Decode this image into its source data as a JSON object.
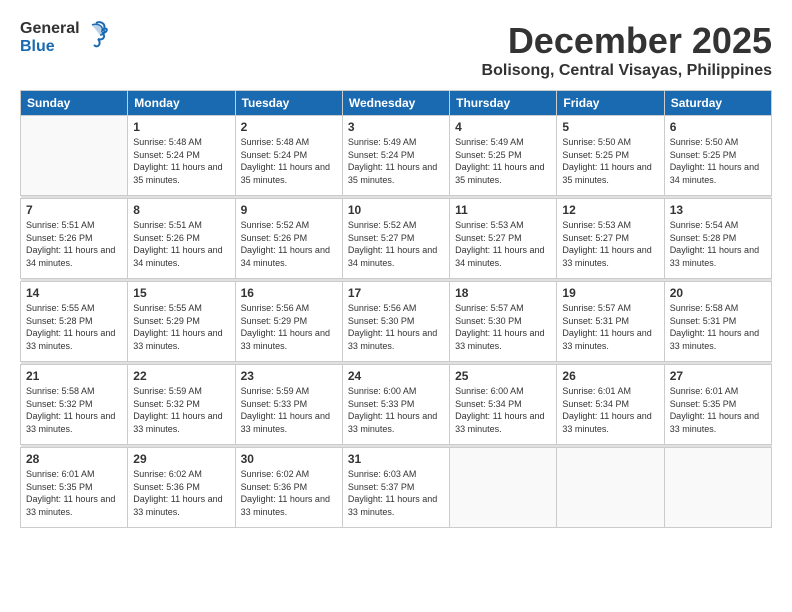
{
  "logo": {
    "text_general": "General",
    "text_blue": "Blue"
  },
  "title": {
    "month_year": "December 2025",
    "location": "Bolisong, Central Visayas, Philippines"
  },
  "header_days": [
    "Sunday",
    "Monday",
    "Tuesday",
    "Wednesday",
    "Thursday",
    "Friday",
    "Saturday"
  ],
  "weeks": [
    [
      {
        "day": "",
        "sunrise": "",
        "sunset": "",
        "daylight": ""
      },
      {
        "day": "1",
        "sunrise": "Sunrise: 5:48 AM",
        "sunset": "Sunset: 5:24 PM",
        "daylight": "Daylight: 11 hours and 35 minutes."
      },
      {
        "day": "2",
        "sunrise": "Sunrise: 5:48 AM",
        "sunset": "Sunset: 5:24 PM",
        "daylight": "Daylight: 11 hours and 35 minutes."
      },
      {
        "day": "3",
        "sunrise": "Sunrise: 5:49 AM",
        "sunset": "Sunset: 5:24 PM",
        "daylight": "Daylight: 11 hours and 35 minutes."
      },
      {
        "day": "4",
        "sunrise": "Sunrise: 5:49 AM",
        "sunset": "Sunset: 5:25 PM",
        "daylight": "Daylight: 11 hours and 35 minutes."
      },
      {
        "day": "5",
        "sunrise": "Sunrise: 5:50 AM",
        "sunset": "Sunset: 5:25 PM",
        "daylight": "Daylight: 11 hours and 35 minutes."
      },
      {
        "day": "6",
        "sunrise": "Sunrise: 5:50 AM",
        "sunset": "Sunset: 5:25 PM",
        "daylight": "Daylight: 11 hours and 34 minutes."
      }
    ],
    [
      {
        "day": "7",
        "sunrise": "Sunrise: 5:51 AM",
        "sunset": "Sunset: 5:26 PM",
        "daylight": "Daylight: 11 hours and 34 minutes."
      },
      {
        "day": "8",
        "sunrise": "Sunrise: 5:51 AM",
        "sunset": "Sunset: 5:26 PM",
        "daylight": "Daylight: 11 hours and 34 minutes."
      },
      {
        "day": "9",
        "sunrise": "Sunrise: 5:52 AM",
        "sunset": "Sunset: 5:26 PM",
        "daylight": "Daylight: 11 hours and 34 minutes."
      },
      {
        "day": "10",
        "sunrise": "Sunrise: 5:52 AM",
        "sunset": "Sunset: 5:27 PM",
        "daylight": "Daylight: 11 hours and 34 minutes."
      },
      {
        "day": "11",
        "sunrise": "Sunrise: 5:53 AM",
        "sunset": "Sunset: 5:27 PM",
        "daylight": "Daylight: 11 hours and 34 minutes."
      },
      {
        "day": "12",
        "sunrise": "Sunrise: 5:53 AM",
        "sunset": "Sunset: 5:27 PM",
        "daylight": "Daylight: 11 hours and 33 minutes."
      },
      {
        "day": "13",
        "sunrise": "Sunrise: 5:54 AM",
        "sunset": "Sunset: 5:28 PM",
        "daylight": "Daylight: 11 hours and 33 minutes."
      }
    ],
    [
      {
        "day": "14",
        "sunrise": "Sunrise: 5:55 AM",
        "sunset": "Sunset: 5:28 PM",
        "daylight": "Daylight: 11 hours and 33 minutes."
      },
      {
        "day": "15",
        "sunrise": "Sunrise: 5:55 AM",
        "sunset": "Sunset: 5:29 PM",
        "daylight": "Daylight: 11 hours and 33 minutes."
      },
      {
        "day": "16",
        "sunrise": "Sunrise: 5:56 AM",
        "sunset": "Sunset: 5:29 PM",
        "daylight": "Daylight: 11 hours and 33 minutes."
      },
      {
        "day": "17",
        "sunrise": "Sunrise: 5:56 AM",
        "sunset": "Sunset: 5:30 PM",
        "daylight": "Daylight: 11 hours and 33 minutes."
      },
      {
        "day": "18",
        "sunrise": "Sunrise: 5:57 AM",
        "sunset": "Sunset: 5:30 PM",
        "daylight": "Daylight: 11 hours and 33 minutes."
      },
      {
        "day": "19",
        "sunrise": "Sunrise: 5:57 AM",
        "sunset": "Sunset: 5:31 PM",
        "daylight": "Daylight: 11 hours and 33 minutes."
      },
      {
        "day": "20",
        "sunrise": "Sunrise: 5:58 AM",
        "sunset": "Sunset: 5:31 PM",
        "daylight": "Daylight: 11 hours and 33 minutes."
      }
    ],
    [
      {
        "day": "21",
        "sunrise": "Sunrise: 5:58 AM",
        "sunset": "Sunset: 5:32 PM",
        "daylight": "Daylight: 11 hours and 33 minutes."
      },
      {
        "day": "22",
        "sunrise": "Sunrise: 5:59 AM",
        "sunset": "Sunset: 5:32 PM",
        "daylight": "Daylight: 11 hours and 33 minutes."
      },
      {
        "day": "23",
        "sunrise": "Sunrise: 5:59 AM",
        "sunset": "Sunset: 5:33 PM",
        "daylight": "Daylight: 11 hours and 33 minutes."
      },
      {
        "day": "24",
        "sunrise": "Sunrise: 6:00 AM",
        "sunset": "Sunset: 5:33 PM",
        "daylight": "Daylight: 11 hours and 33 minutes."
      },
      {
        "day": "25",
        "sunrise": "Sunrise: 6:00 AM",
        "sunset": "Sunset: 5:34 PM",
        "daylight": "Daylight: 11 hours and 33 minutes."
      },
      {
        "day": "26",
        "sunrise": "Sunrise: 6:01 AM",
        "sunset": "Sunset: 5:34 PM",
        "daylight": "Daylight: 11 hours and 33 minutes."
      },
      {
        "day": "27",
        "sunrise": "Sunrise: 6:01 AM",
        "sunset": "Sunset: 5:35 PM",
        "daylight": "Daylight: 11 hours and 33 minutes."
      }
    ],
    [
      {
        "day": "28",
        "sunrise": "Sunrise: 6:01 AM",
        "sunset": "Sunset: 5:35 PM",
        "daylight": "Daylight: 11 hours and 33 minutes."
      },
      {
        "day": "29",
        "sunrise": "Sunrise: 6:02 AM",
        "sunset": "Sunset: 5:36 PM",
        "daylight": "Daylight: 11 hours and 33 minutes."
      },
      {
        "day": "30",
        "sunrise": "Sunrise: 6:02 AM",
        "sunset": "Sunset: 5:36 PM",
        "daylight": "Daylight: 11 hours and 33 minutes."
      },
      {
        "day": "31",
        "sunrise": "Sunrise: 6:03 AM",
        "sunset": "Sunset: 5:37 PM",
        "daylight": "Daylight: 11 hours and 33 minutes."
      },
      {
        "day": "",
        "sunrise": "",
        "sunset": "",
        "daylight": ""
      },
      {
        "day": "",
        "sunrise": "",
        "sunset": "",
        "daylight": ""
      },
      {
        "day": "",
        "sunrise": "",
        "sunset": "",
        "daylight": ""
      }
    ]
  ]
}
